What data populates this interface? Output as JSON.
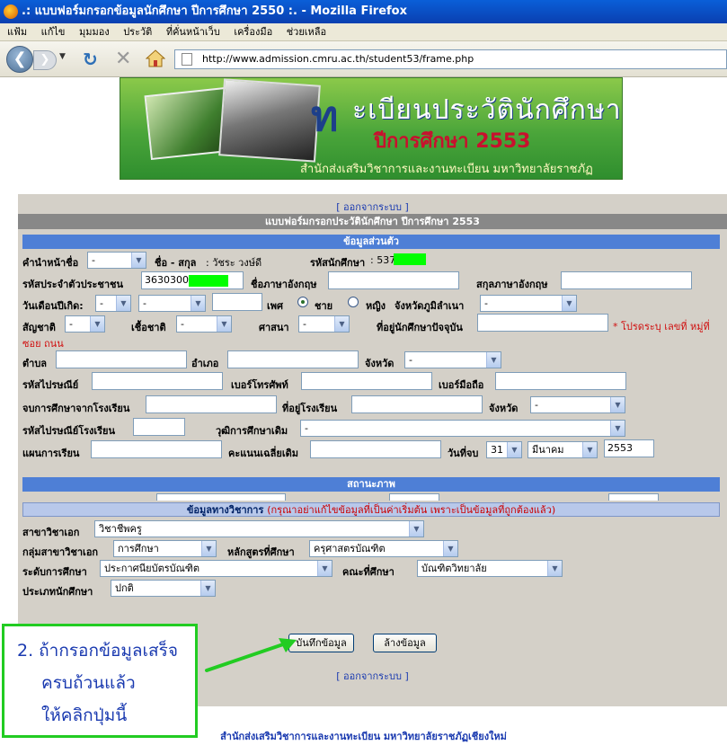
{
  "window": {
    "title": ".: แบบฟอร์มกรอกข้อมูลนักศึกษา ปีการศึกษา 2550 :. - Mozilla Firefox"
  },
  "menu": [
    "แฟ้ม",
    "แก้ไข",
    "มุมมอง",
    "ประวัติ",
    "ที่คั่นหน้าเว็บ",
    "เครื่องมือ",
    "ช่วยเหลือ"
  ],
  "toolbar": {
    "url": "http://www.admission.cmru.ac.th/student53/frame.php"
  },
  "banner": {
    "title_letter": "ท",
    "title_rest": "ะเบียนประวัตินักศึกษา",
    "year_line": "ปีการศึกษา 2553",
    "office_line": "สำนักส่งเสริมวิชาการและงานทะเบียน มหาวิทยาลัยราชภัฏเชียงใหม่"
  },
  "form": {
    "logout": "ออกจากระบบ",
    "title": "แบบฟอร์มกรอกประวัตินักศึกษา ปีการศึกษา 2553",
    "personal_section": "ข้อมูลส่วนตัว",
    "prefix_label": "คำนำหน้าชื่อ",
    "prefix_value": "-",
    "name_label": "ชื่อ - สกุล",
    "name_value": ": วัชระ   วงษ์ดี",
    "student_id_label": "รหัสนักศึกษา",
    "student_id_value": ": 537",
    "citizen_id_label": "รหัสประจำตัวประชาชน",
    "citizen_id_value": "3630300",
    "en_name_label": "ชื่อภาษาอังกฤษ",
    "en_surname_label": "สกุลภาษาอังกฤษ",
    "birth_label": "วันเดือนปีเกิด:",
    "birth_day": "-",
    "birth_month": "-",
    "sex_label": "เพศ",
    "male": "ชาย",
    "female": "หญิง",
    "birth_province_label": "จังหวัดภูมิลำเนา",
    "birth_province": "-",
    "nationality_label": "สัญชาติ",
    "nationality": "-",
    "race_label": "เชื้อชาติ",
    "race": "-",
    "religion_label": "ศาสนา",
    "religion": "-",
    "address_label": "ที่อยู่นักศึกษาปัจจุบัน",
    "address_note_1": "* โปรดระบุ เลขที่ หมู่ที่",
    "address_note_2": "ซอย ถนน",
    "subdistrict_label": "ตำบล",
    "district_label": "อำเภอ",
    "province_label": "จังหวัด",
    "province_value": "-",
    "postcode_label": "รหัสไปรษณีย์",
    "phone_label": "เบอร์โทรศัพท์",
    "mobile_label": "เบอร์มือถือ",
    "graduated_from_label": "จบการศึกษาจากโรงเรียน",
    "school_address_label": "ที่อยู่โรงเรียน",
    "school_province_label": "จังหวัด",
    "school_province_value": "-",
    "school_postcode_label": "รหัสไปรษณีย์โรงเรียน",
    "prior_degree_label": "วุฒิการศึกษาเดิม",
    "prior_degree_value": "-",
    "study_plan_label": "แผนการเรียน",
    "gpa_label": "คะแนนเฉลี่ยเดิม",
    "grad_date_label": "วันที่จบ",
    "grad_day": "31",
    "grad_month": "มีนาคม",
    "grad_year": "2553",
    "status_section": "สถานะภาพ",
    "academic_section": "ข้อมูลทางวิชาการ",
    "academic_note": "(กรุณาอย่าแก้ไขข้อมูลที่เป็นค่าเริ่มต้น เพราะเป็นข้อมูลที่ถูกต้องแล้ว)",
    "major_label": "สาขาวิชาเอก",
    "major_value": "วิชาชีพครู",
    "major_group_label": "กลุ่มสาขาวิชาเอก",
    "major_group_value": "การศึกษา",
    "curriculum_label": "หลักสูตรที่ศึกษา",
    "curriculum_value": "ครุศาสตรบัณฑิต",
    "level_label": "ระดับการศึกษา",
    "level_value": "ประกาศนียบัตรบัณฑิต",
    "faculty_label": "คณะที่ศึกษา",
    "faculty_value": "บัณฑิตวิทยาลัย",
    "student_type_label": "ประเภทนักศึกษา",
    "student_type_value": "ปกติ",
    "save_button": "บันทึกข้อมูล",
    "clear_button": "ล้างข้อมูล"
  },
  "callout": {
    "line1": "2.  ถ้ากรอกข้อมูลเสร็จ",
    "line2": "ครบถ้วนแล้ว",
    "line3": "ให้คลิกปุ่มนี้"
  },
  "footer": "สำนักส่งเสริมวิชาการและงานทะเบียน มหาวิทยาลัยราชภัฏเชียงใหม่",
  "colors": {
    "title_bar": "#0a50c8",
    "section_blue": "#4e7fd6",
    "callout_green": "#22cc22",
    "note_red": "#d01010"
  }
}
